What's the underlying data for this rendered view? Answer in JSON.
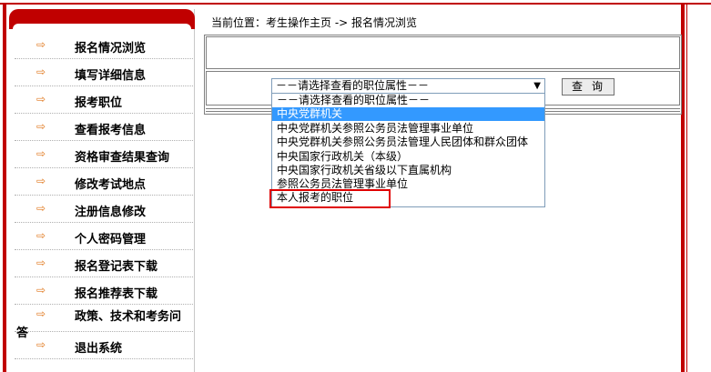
{
  "breadcrumb": {
    "text": "当前位置：考生操作主页 -> 报名情况浏览"
  },
  "sidebar": {
    "items": [
      {
        "label": "报名情况浏览"
      },
      {
        "label": "填写详细信息"
      },
      {
        "label": "报考职位"
      },
      {
        "label": "查看报考信息"
      },
      {
        "label": "资格审查结果查询"
      },
      {
        "label": "修改考试地点"
      },
      {
        "label": "注册信息修改"
      },
      {
        "label": "个人密码管理"
      },
      {
        "label": "报名登记表下载"
      },
      {
        "label": "报名推荐表下载"
      },
      {
        "label_line1": "政策、技术和考务问",
        "label_line2": "答"
      },
      {
        "label": "退出系统"
      }
    ]
  },
  "filter": {
    "selected": "－－请选择查看的职位属性－－",
    "query_label": "查询",
    "options": [
      "－－请选择查看的职位属性－－",
      "中央党群机关",
      "中央党群机关参照公务员法管理事业单位",
      "中央党群机关参照公务员法管理人民团体和群众团体",
      "中央国家行政机关（本级）",
      "中央国家行政机关省级以下直属机构",
      "参照公务员法管理事业单位",
      "本人报考的职位"
    ],
    "highlighted_option": "中央党群机关",
    "annotated_option": "本人报考的职位"
  },
  "colors": {
    "frame": "#c00000",
    "arrow": "#e0781e",
    "selection": "#3399ff",
    "annotation": "#e00000"
  }
}
